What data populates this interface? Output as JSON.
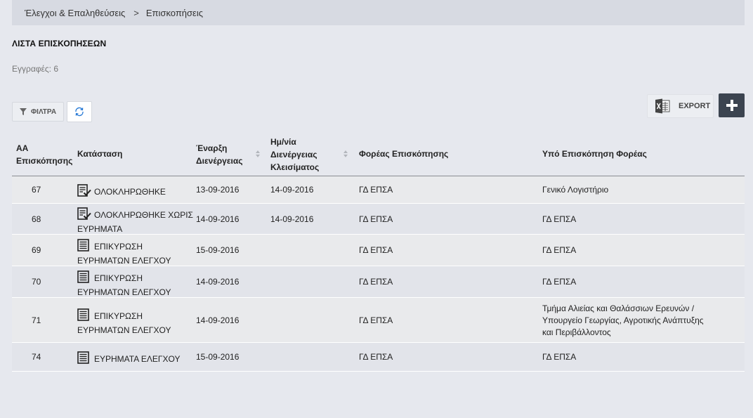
{
  "breadcrumb": {
    "parent": "Έλεγχοι & Επαληθεύσεις",
    "separator": ">",
    "current": "Επισκοπήσεις"
  },
  "page": {
    "title": "ΛΙΣΤΑ ΕΠΙΣΚΟΠΗΣΕΩΝ",
    "record_count": "Εγγραφές: 6"
  },
  "toolbar": {
    "filter_label": "ΦΙΛΤΡΑ",
    "export_label": "EXPORT",
    "add_icon": "plus-icon",
    "refresh_icon": "refresh-icon",
    "excel_icon": "excel-icon"
  },
  "colors": {
    "accent_dark": "#3c4450",
    "page_bg": "#e6e8ee",
    "breadcrumb_bg": "#d7dae2"
  },
  "table": {
    "headers": {
      "id": [
        "ΑΑ",
        "Επισκόπησης"
      ],
      "status": "Κατάσταση",
      "start": [
        "Έναρξη",
        "Διενέργειας"
      ],
      "close": [
        "Ημ/νία",
        "Διενέργειας",
        "Κλεισίματος"
      ],
      "agency": "Φορέας Επισκόπησης",
      "audited": "Υπό Επισκόπηση Φορέας"
    },
    "rows": [
      {
        "id": "67",
        "status_icon": "checked-document-icon",
        "status": [
          "ΟΛΟΚΛΗΡΩΘΗΚΕ"
        ],
        "start": "13-09-2016",
        "close": "14-09-2016",
        "agency": "ΓΔ ΕΠΣΑ",
        "audited": [
          "Γενικό Λογιστήριο"
        ]
      },
      {
        "id": "68",
        "status_icon": "checked-document-icon",
        "status": [
          "ΟΛΟΚΛΗΡΩΘΗΚΕ ΧΩΡΙΣ",
          "ΕΥΡΗΜΑΤΑ"
        ],
        "start": "14-09-2016",
        "close": "14-09-2016",
        "agency": "ΓΔ ΕΠΣΑ",
        "audited": [
          "ΓΔ ΕΠΣΑ"
        ]
      },
      {
        "id": "69",
        "status_icon": "document-icon",
        "status": [
          "ΕΠΙΚΥΡΩΣΗ",
          "ΕΥΡΗΜΑΤΩΝ ΕΛΕΓΧΟΥ"
        ],
        "start": "15-09-2016",
        "close": "",
        "agency": "ΓΔ ΕΠΣΑ",
        "audited": [
          "ΓΔ ΕΠΣΑ"
        ]
      },
      {
        "id": "70",
        "status_icon": "document-icon",
        "status": [
          "ΕΠΙΚΥΡΩΣΗ",
          "ΕΥΡΗΜΑΤΩΝ ΕΛΕΓΧΟΥ"
        ],
        "start": "14-09-2016",
        "close": "",
        "agency": "ΓΔ ΕΠΣΑ",
        "audited": [
          "ΓΔ ΕΠΣΑ"
        ]
      },
      {
        "id": "71",
        "status_icon": "document-icon",
        "status": [
          "ΕΠΙΚΥΡΩΣΗ",
          "ΕΥΡΗΜΑΤΩΝ ΕΛΕΓΧΟΥ"
        ],
        "start": "14-09-2016",
        "close": "",
        "agency": "ΓΔ ΕΠΣΑ",
        "audited": [
          "Τμήμα Αλιείας και Θαλάσσιων Ερευνών /",
          "Υπουργείο Γεωργίας, Αγροτικής Ανάπτυξης",
          "και Περιβάλλοντος"
        ]
      },
      {
        "id": "74",
        "status_icon": "document-icon",
        "status": [
          "ΕΥΡΗΜΑΤΑ ΕΛΕΓΧΟΥ"
        ],
        "start": "15-09-2016",
        "close": "",
        "agency": "ΓΔ ΕΠΣΑ",
        "audited": [
          "ΓΔ ΕΠΣΑ"
        ]
      }
    ]
  }
}
